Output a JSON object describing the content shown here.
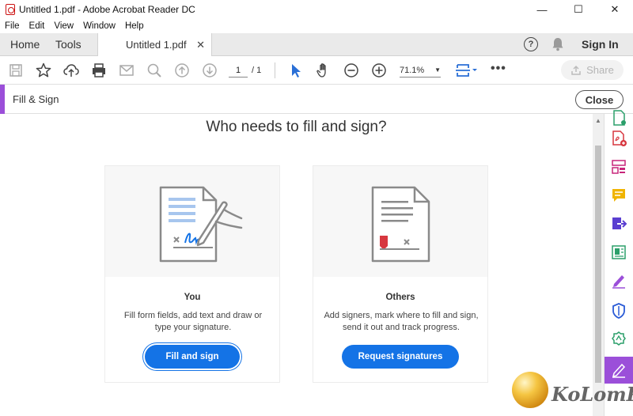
{
  "window": {
    "title": "Untitled 1.pdf - Adobe Acrobat Reader DC",
    "minimize": "—",
    "maximize": "☐",
    "close": "✕"
  },
  "menu": [
    "File",
    "Edit",
    "View",
    "Window",
    "Help"
  ],
  "tabs": {
    "home": "Home",
    "tools": "Tools",
    "doc": "Untitled 1.pdf",
    "doc_close": "✕",
    "help": "?",
    "sign_in": "Sign In"
  },
  "toolbar": {
    "page_current": "1",
    "page_total": "/ 1",
    "zoom": "71.1%",
    "zoom_arrow": "▼",
    "more": "•••",
    "share": "Share"
  },
  "fill_sign": {
    "label": "Fill & Sign",
    "close": "Close",
    "heading": "Who needs to fill and sign?",
    "cards": [
      {
        "title": "You",
        "description": "Fill form fields, add text and draw or type your signature.",
        "button": "Fill and sign"
      },
      {
        "title": "Others",
        "description": "Add signers, mark where to fill and sign, send it out and track progress.",
        "button": "Request signatures"
      }
    ]
  },
  "scrollbar": {
    "up": "▲"
  },
  "watermark": {
    "text": "KoLomPC"
  },
  "colors": {
    "accent_purple": "#9b4fd9",
    "primary_blue": "#1473e6",
    "toolbar_blue": "#2a6fd6"
  }
}
